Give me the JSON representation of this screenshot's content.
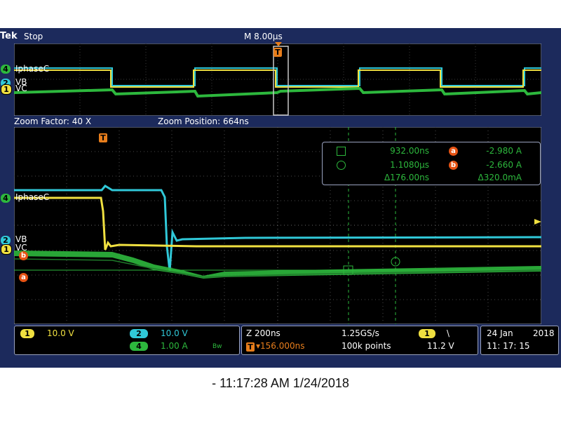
{
  "scope": {
    "brand": "Tek",
    "run_state": "Stop",
    "horizontal": "M 8.00µs",
    "trigger_marker": "T",
    "overview": {
      "labels": [
        {
          "ch": "4",
          "name": "IphaseC",
          "color": "#2db83d"
        },
        {
          "ch": "2",
          "name": "VB",
          "color": "#30c8d8"
        },
        {
          "ch": "1",
          "name": "VC",
          "color": "#f0e040"
        }
      ]
    },
    "zoom": {
      "factor": "Zoom Factor: 40 X",
      "position": "Zoom Position: 664ns"
    },
    "main": {
      "labels": [
        {
          "ch": "4",
          "name": "IphaseC"
        },
        {
          "ch": "2",
          "name": "VB"
        },
        {
          "ch": "1",
          "name": "VC"
        }
      ],
      "cursor_labels": [
        "b",
        "a"
      ]
    },
    "cursors": {
      "square_time": "932.00ns",
      "circle_time": "1.1080µs",
      "delta_time": "Δ176.00ns",
      "a_label": "a",
      "a_value": "-2.980 A",
      "b_label": "b",
      "b_value": "-2.660 A",
      "delta_value": "Δ320.0mA"
    },
    "status": {
      "ch1_num": "1",
      "ch1_scale": "10.0 V",
      "ch2_num": "2",
      "ch2_scale": "10.0 V",
      "ch4_num": "4",
      "ch4_scale": "1.00 A",
      "bw": "Bw",
      "zoom_time": "Z 200ns",
      "sample_rate": "1.25GS/s",
      "trig_pos": "▾156.000ns",
      "record": "100k points",
      "trig_src": "1",
      "trig_slope": "\\",
      "trig_level": "11.2 V",
      "date_day": "24 Jan",
      "date_year": "2018",
      "clock": "11: 17: 15"
    },
    "colors": {
      "ch1": "#f0e040",
      "ch2": "#30c8d8",
      "ch4": "#2db83d",
      "cursor": "#e65314",
      "background": "#000000"
    }
  },
  "footer": "- 11:17:28 AM    1/24/2018"
}
